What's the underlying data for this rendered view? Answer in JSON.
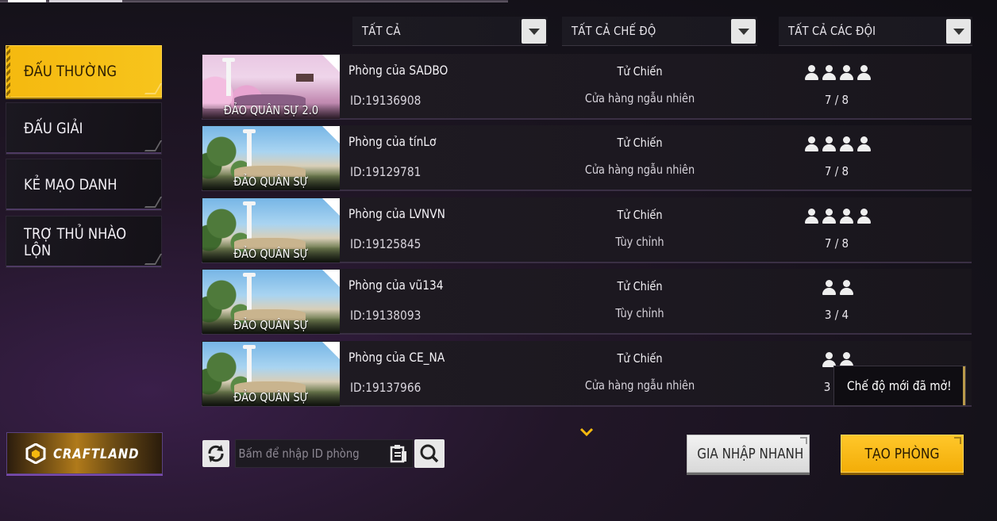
{
  "filters": {
    "all": "TẤT CẢ",
    "all_modes": "TẤT CẢ CHẾ ĐỘ",
    "all_teams": "TẤT CẢ CÁC ĐỘI"
  },
  "tabs": [
    {
      "label": "ĐẤU THƯỜNG",
      "active": true
    },
    {
      "label": "ĐẤU GIẢI",
      "active": false
    },
    {
      "label": "KẺ MẠO DANH",
      "active": false
    },
    {
      "label": "TRỢ THỦ NHÀO LỘN",
      "active": false
    }
  ],
  "craftland": {
    "label": "CRAFTLAND",
    "icon": "craftland-logo-icon"
  },
  "rooms": [
    {
      "map": "ĐẢO QUÂN SỰ 2.0",
      "name": "Phòng của SADBO",
      "id": "ID:19136908",
      "mode": "Tử Chiến",
      "sub": "Cửa hàng ngẫu nhiên",
      "players_icons": 4,
      "count": "7 / 8"
    },
    {
      "map": "ĐẢO QUÂN SỰ",
      "name": "Phòng của tínLơ",
      "id": "ID:19129781",
      "mode": "Tử Chiến",
      "sub": "Cửa hàng ngẫu nhiên",
      "players_icons": 4,
      "count": "7 / 8"
    },
    {
      "map": "ĐẢO QUÂN SỰ",
      "name": "Phòng của LVNVN",
      "id": "ID:19125845",
      "mode": "Tử Chiến",
      "sub": "Tùy chỉnh",
      "players_icons": 4,
      "count": "7 / 8"
    },
    {
      "map": "ĐẢO QUÂN SỰ",
      "name": "Phòng của vũ134",
      "id": "ID:19138093",
      "mode": "Tử Chiến",
      "sub": "Tùy chỉnh",
      "players_icons": 2,
      "count": "3 / 4"
    },
    {
      "map": "ĐẢO QUÂN SỰ",
      "name": "Phòng của CE_NA",
      "id": "ID:19137966",
      "mode": "Tử Chiến",
      "sub": "Cửa hàng ngẫu nhiên",
      "players_icons": 2,
      "count": "3"
    }
  ],
  "tooltip": "Chế độ mới đã mở!",
  "search": {
    "placeholder": "Bấm để nhập ID phòng"
  },
  "buttons": {
    "quick_join": "GIA NHẬP NHANH",
    "create_room": "TẠO PHÒNG"
  },
  "colors": {
    "accent": "#f5b90f",
    "panel": "#1c1820",
    "highlight": "#7a4ab0"
  }
}
